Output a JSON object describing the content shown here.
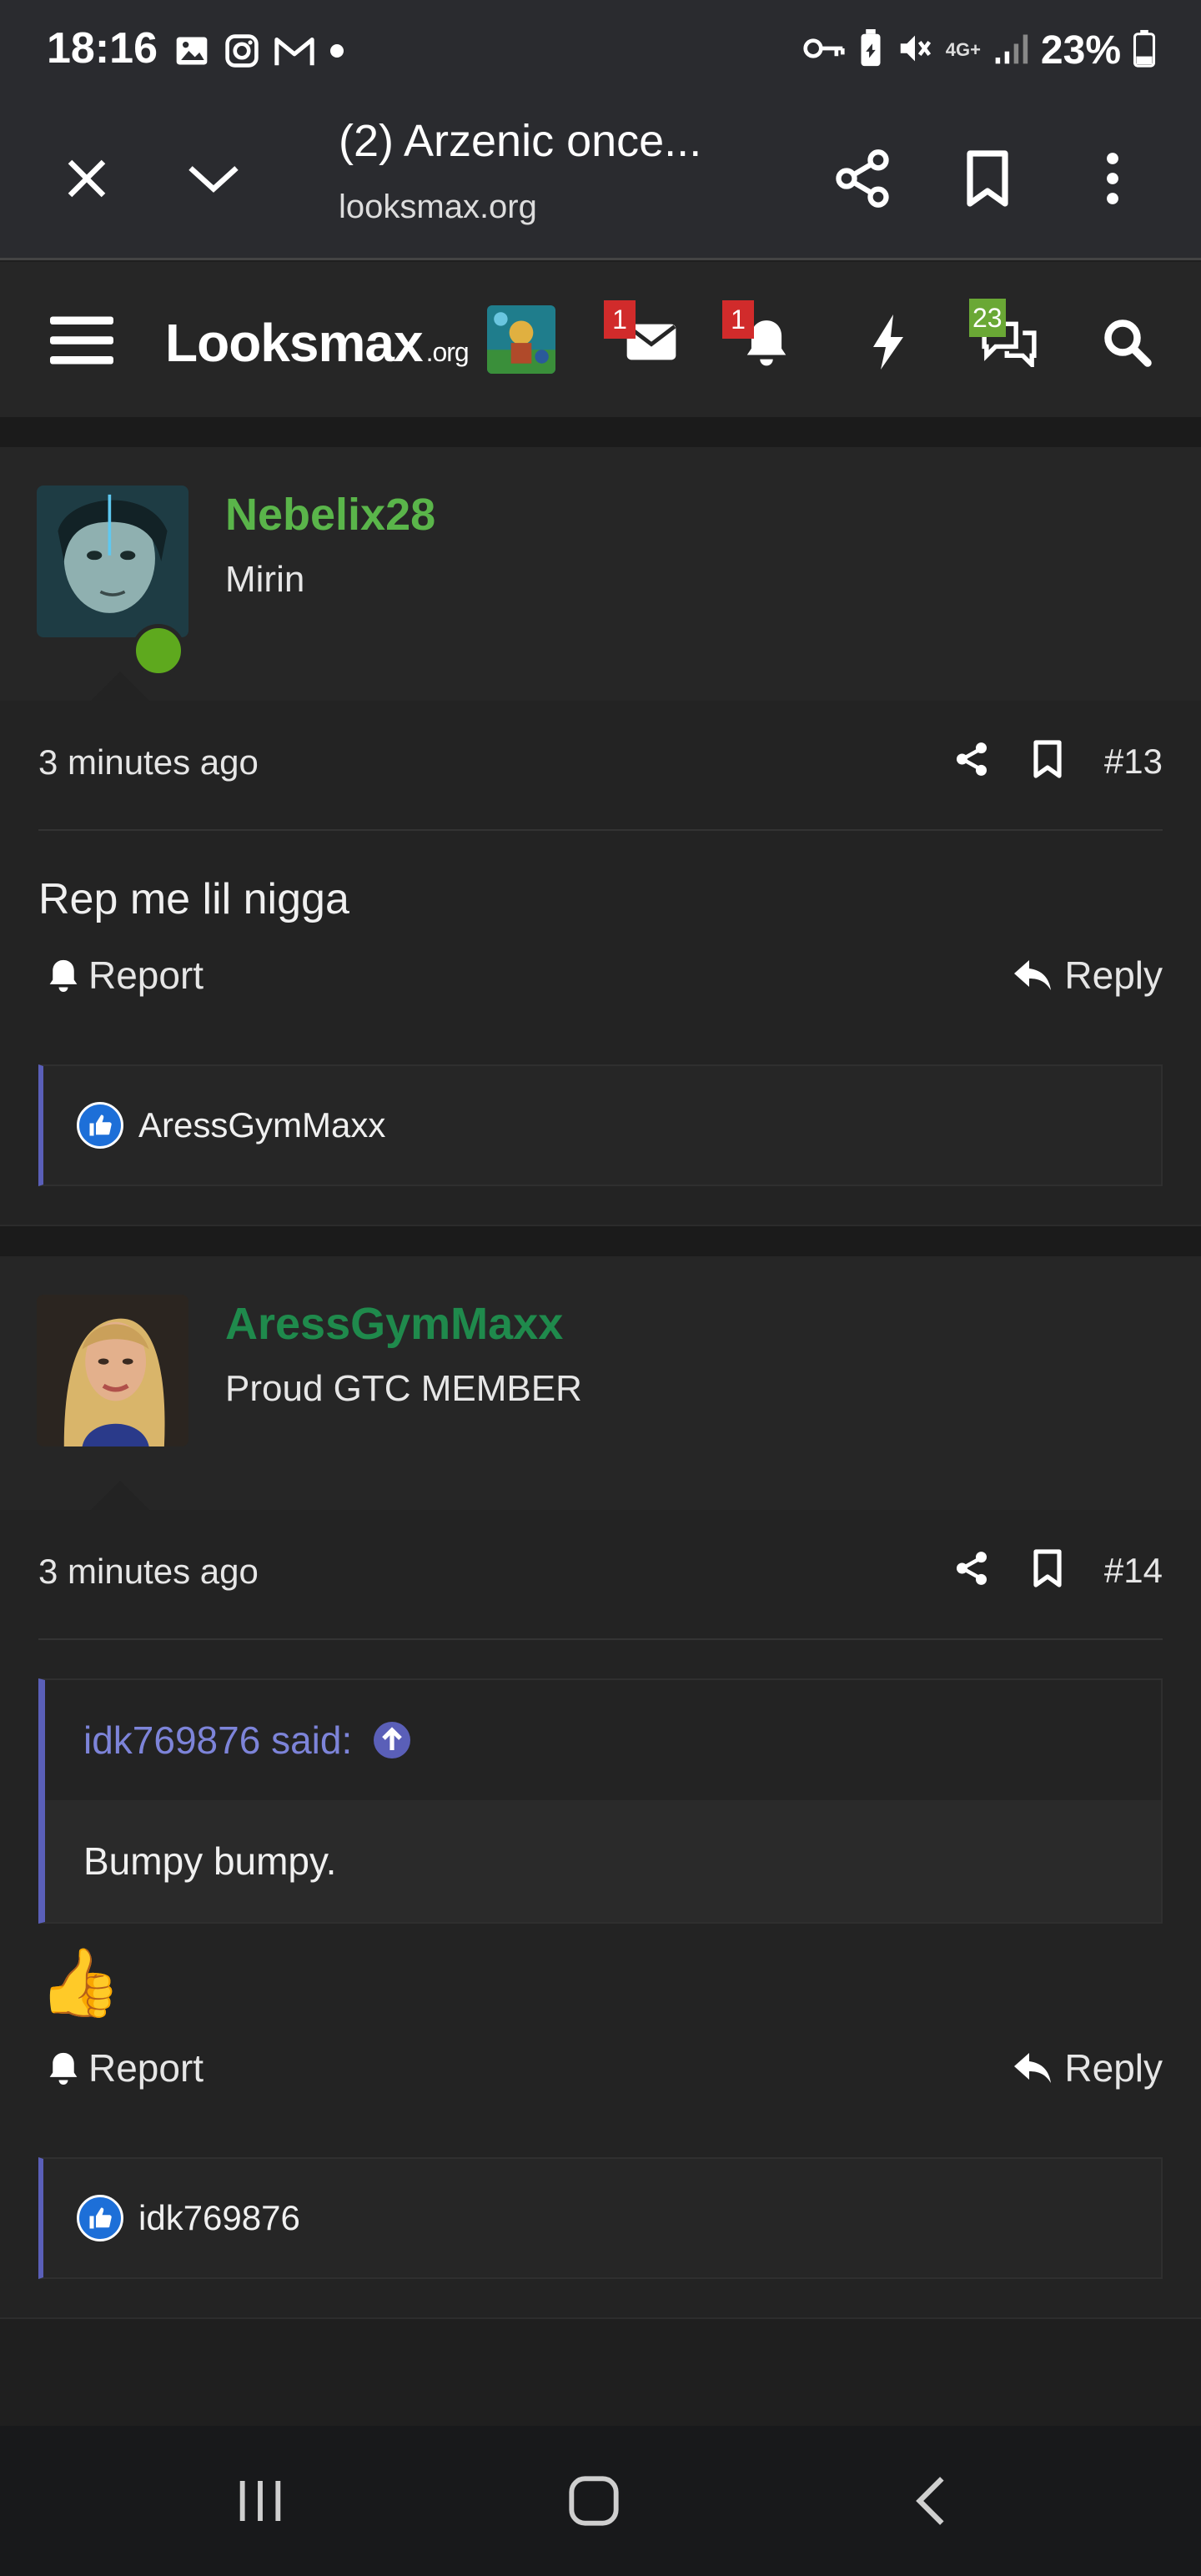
{
  "status_bar": {
    "time": "18:16",
    "network": "4G+",
    "battery": "23%"
  },
  "browser": {
    "title": "(2) Arzenic once...",
    "url": "looksmax.org"
  },
  "site": {
    "logo_text": "Looksmax",
    "logo_suffix": ".org",
    "inbox_badge": "1",
    "alerts_badge": "1",
    "conversations_badge": "23"
  },
  "posts": [
    {
      "username": "Nebelix28",
      "user_title": "Mirin",
      "time": "3 minutes ago",
      "number": "#13",
      "message": "Rep me lil nigga",
      "report_label": "Report",
      "reply_label": "Reply",
      "likes": "AressGymMaxx"
    },
    {
      "username": "AressGymMaxx",
      "user_title": "Proud GTC MEMBER",
      "time": "3 minutes ago",
      "number": "#14",
      "quote_author": "idk769876 said:",
      "quote_text": "Bumpy bumpy.",
      "emoji": "👍",
      "report_label": "Report",
      "reply_label": "Reply",
      "likes": "idk769876"
    }
  ],
  "colors": {
    "username_green": "#5ab54a",
    "username_dark_green": "#1f8a4c",
    "quote_accent": "#5a5fb8",
    "quote_author": "#7d84d9",
    "badge_red": "#d12b2b",
    "badge_green": "#6aa835"
  }
}
